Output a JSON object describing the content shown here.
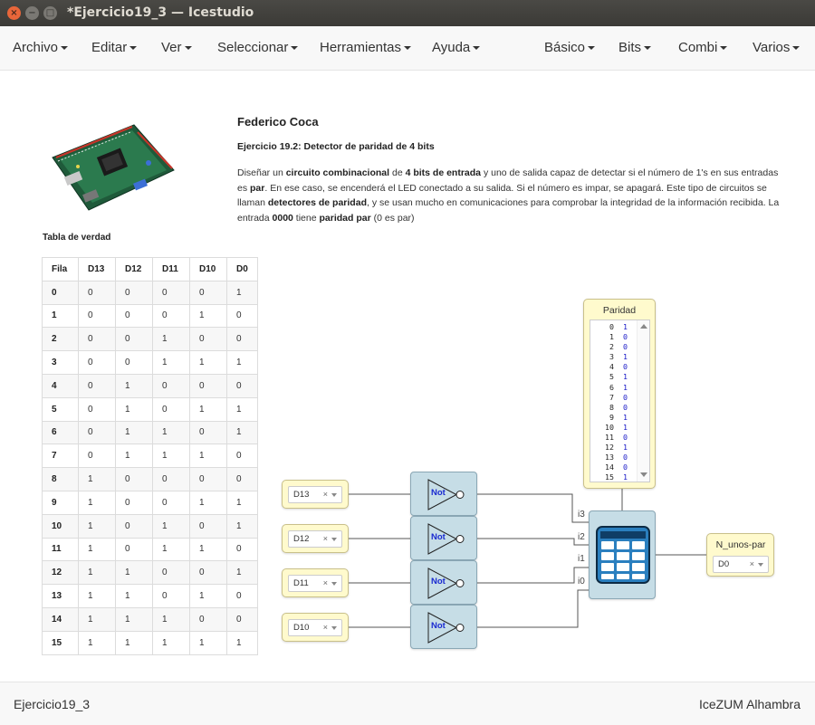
{
  "window": {
    "title": "*Ejercicio19_3 — Icestudio",
    "close_glyph": "×",
    "minimize_glyph": "−",
    "maximize_glyph": "□"
  },
  "menu": {
    "left": [
      "Archivo",
      "Editar",
      "Ver",
      "Seleccionar",
      "Herramientas",
      "Ayuda"
    ],
    "right": [
      "Básico",
      "Bits",
      "Combi",
      "Varios"
    ]
  },
  "document": {
    "author": "Federico Coca",
    "subtitle": "Ejercicio 19.2: Detector de paridad de 4 bits",
    "description": {
      "p1": "Diseñar un ",
      "b1": "circuito combinacional",
      "p2": " de ",
      "b2": "4 bits de entrada",
      "p3": " y uno de salida capaz de detectar si el número de 1's en sus entradas es ",
      "b3": "par",
      "p4": ". En ese caso, se encenderá el LED conectado a su salida. Si el número es impar, se apagará. Este tipo de circuitos se llaman ",
      "b4": "detectores de paridad",
      "p5": ", y se usan mucho en comunicaciones para comprobar la integridad de la información recibida. La entrada ",
      "b5": "0000",
      "p6": " tiene ",
      "b6": "paridad par",
      "p7": " (0 es par)"
    }
  },
  "truth_table": {
    "title": "Tabla de verdad",
    "headers": [
      "Fila",
      "D13",
      "D12",
      "D11",
      "D10",
      "D0"
    ],
    "rows": [
      [
        "0",
        "0",
        "0",
        "0",
        "0",
        "1"
      ],
      [
        "1",
        "0",
        "0",
        "0",
        "1",
        "0"
      ],
      [
        "2",
        "0",
        "0",
        "1",
        "0",
        "0"
      ],
      [
        "3",
        "0",
        "0",
        "1",
        "1",
        "1"
      ],
      [
        "4",
        "0",
        "1",
        "0",
        "0",
        "0"
      ],
      [
        "5",
        "0",
        "1",
        "0",
        "1",
        "1"
      ],
      [
        "6",
        "0",
        "1",
        "1",
        "0",
        "1"
      ],
      [
        "7",
        "0",
        "1",
        "1",
        "1",
        "0"
      ],
      [
        "8",
        "1",
        "0",
        "0",
        "0",
        "0"
      ],
      [
        "9",
        "1",
        "0",
        "0",
        "1",
        "1"
      ],
      [
        "10",
        "1",
        "0",
        "1",
        "0",
        "1"
      ],
      [
        "11",
        "1",
        "0",
        "1",
        "1",
        "0"
      ],
      [
        "12",
        "1",
        "1",
        "0",
        "0",
        "1"
      ],
      [
        "13",
        "1",
        "1",
        "0",
        "1",
        "0"
      ],
      [
        "14",
        "1",
        "1",
        "1",
        "0",
        "0"
      ],
      [
        "15",
        "1",
        "1",
        "1",
        "1",
        "1"
      ]
    ]
  },
  "circuit": {
    "inputs": [
      "D13",
      "D12",
      "D11",
      "D10"
    ],
    "clear_glyph": "×",
    "not_label": "Not",
    "table_ports": [
      "i3",
      "i2",
      "i1",
      "i0"
    ],
    "param": {
      "title": "Paridad",
      "entries": [
        [
          "0",
          "1"
        ],
        [
          "1",
          "0"
        ],
        [
          "2",
          "0"
        ],
        [
          "3",
          "1"
        ],
        [
          "4",
          "0"
        ],
        [
          "5",
          "1"
        ],
        [
          "6",
          "1"
        ],
        [
          "7",
          "0"
        ],
        [
          "8",
          "0"
        ],
        [
          "9",
          "1"
        ],
        [
          "10",
          "1"
        ],
        [
          "11",
          "0"
        ],
        [
          "12",
          "1"
        ],
        [
          "13",
          "0"
        ],
        [
          "14",
          "0"
        ],
        [
          "15",
          "1"
        ]
      ]
    },
    "output": {
      "title": "N_unos-par",
      "value": "D0"
    }
  },
  "footer": {
    "project": "Ejercicio19_3",
    "board": "IceZUM Alhambra"
  },
  "colors": {
    "block_fill": "#c6dde6",
    "io_fill": "#fffacd",
    "not_text": "#1a2ad0",
    "titlebar": "#3b3a36",
    "close_button": "#e8663a"
  }
}
